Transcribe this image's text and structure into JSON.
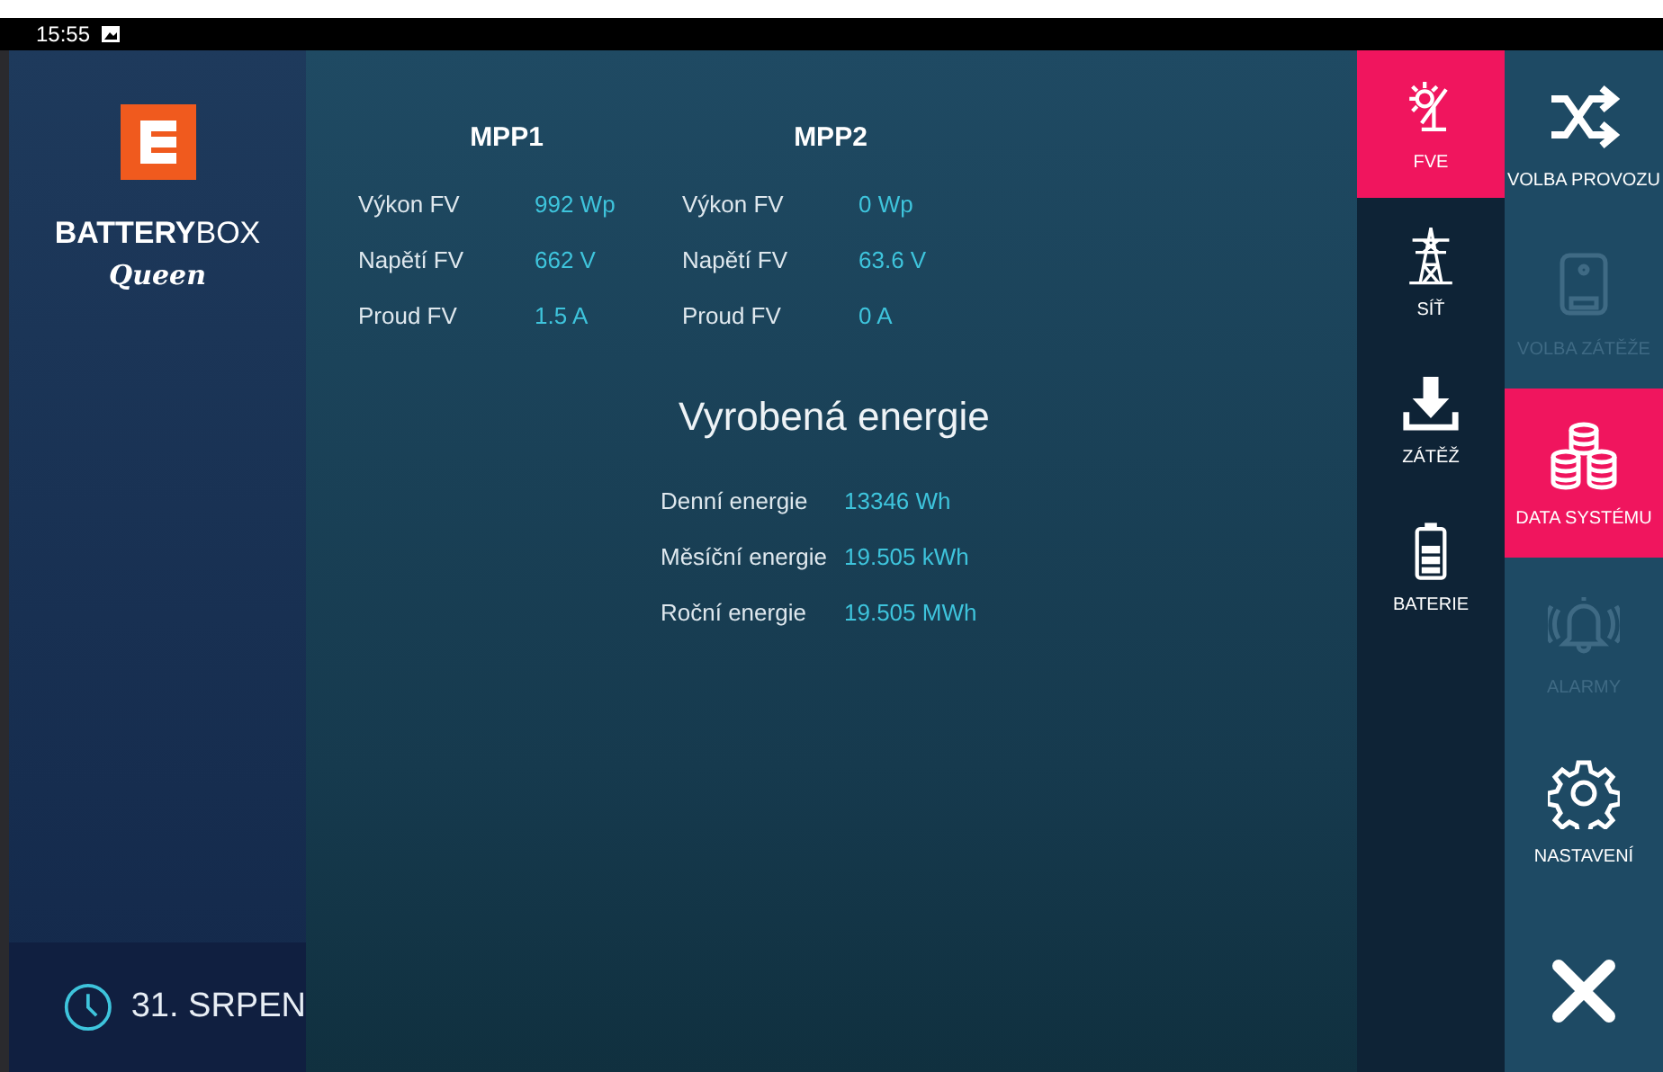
{
  "status_bar": {
    "time": "15:55"
  },
  "brand": {
    "name_bold": "BATTERY",
    "name_light": "BOX",
    "subtitle": "Queen"
  },
  "footer": {
    "date": "31. SRPEN"
  },
  "mpp": [
    {
      "title": "MPP1",
      "rows": [
        {
          "label": "Výkon FV",
          "value": "992 Wp"
        },
        {
          "label": "Napětí FV",
          "value": "662 V"
        },
        {
          "label": "Proud FV",
          "value": "1.5 A"
        }
      ]
    },
    {
      "title": "MPP2",
      "rows": [
        {
          "label": "Výkon FV",
          "value": "0 Wp"
        },
        {
          "label": "Napětí FV",
          "value": "63.6 V"
        },
        {
          "label": "Proud FV",
          "value": "0 A"
        }
      ]
    }
  ],
  "energy": {
    "title": "Vyrobená energie",
    "rows": [
      {
        "label": "Denní energie",
        "value": "13346 Wh"
      },
      {
        "label": "Měsíční energie",
        "value": "19.505 kWh"
      },
      {
        "label": "Roční energie",
        "value": "19.505 MWh"
      }
    ]
  },
  "submenu": [
    {
      "label": "FVE",
      "kind": "solar",
      "selected": true
    },
    {
      "label": "SÍŤ",
      "kind": "pylon",
      "selected": false
    },
    {
      "label": "ZÁTĚŽ",
      "kind": "download",
      "selected": false
    },
    {
      "label": "BATERIE",
      "kind": "battery",
      "selected": false
    }
  ],
  "menu": [
    {
      "label": "VOLBA PROVOZU",
      "kind": "shuffle",
      "selected": false,
      "disabled": false
    },
    {
      "label": "VOLBA ZÁTĚŽE",
      "kind": "boiler",
      "selected": false,
      "disabled": true
    },
    {
      "label": "DATA SYSTÉMU",
      "kind": "database",
      "selected": true,
      "disabled": false
    },
    {
      "label": "ALARMY",
      "kind": "bell",
      "selected": false,
      "disabled": true
    },
    {
      "label": "NASTAVENÍ",
      "kind": "gear",
      "selected": false,
      "disabled": false
    }
  ]
}
